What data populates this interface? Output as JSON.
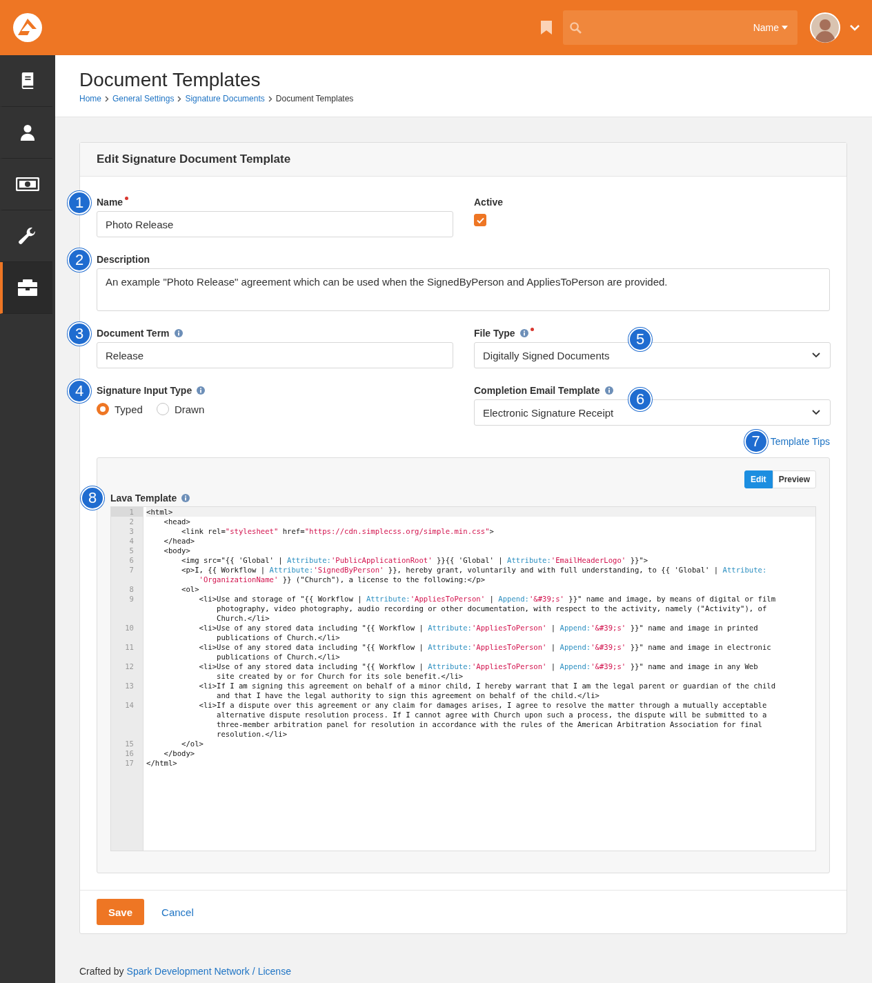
{
  "header": {
    "search_scope": "Name"
  },
  "sidebar": {
    "items": [
      {
        "kind": "book",
        "selected": false
      },
      {
        "kind": "person",
        "selected": false
      },
      {
        "kind": "money",
        "selected": false
      },
      {
        "kind": "wrench",
        "selected": false
      },
      {
        "kind": "briefcase",
        "selected": true
      }
    ]
  },
  "page": {
    "title": "Document Templates",
    "breadcrumbs": [
      "Home",
      "General Settings",
      "Signature Documents",
      "Document Templates"
    ]
  },
  "panel": {
    "title": "Edit Signature Document Template",
    "name": {
      "label": "Name",
      "required": true,
      "callout": "1",
      "value": "Photo Release"
    },
    "active": {
      "label": "Active",
      "checked": true
    },
    "description": {
      "label": "Description",
      "callout": "2",
      "value": "An example \"Photo Release\" agreement which can be used when the SignedByPerson and AppliesToPerson are provided."
    },
    "document_term": {
      "label": "Document Term",
      "callout": "3",
      "value": "Release"
    },
    "file_type": {
      "label": "File Type",
      "required": true,
      "callout": "5",
      "value": "Digitally Signed Documents"
    },
    "signature_input_type": {
      "label": "Signature Input Type",
      "callout": "4",
      "options": [
        {
          "label": "Typed",
          "selected": true
        },
        {
          "label": "Drawn",
          "selected": false
        }
      ]
    },
    "completion_email_template": {
      "label": "Completion Email Template",
      "callout": "6",
      "value": "Electronic Signature Receipt"
    },
    "template_tips": {
      "label": "Template Tips",
      "callout": "7"
    },
    "lava_template": {
      "label": "Lava Template",
      "callout": "8",
      "mode_tabs": [
        {
          "label": "Edit",
          "selected": true
        },
        {
          "label": "Preview",
          "selected": false
        }
      ],
      "code_lines": [
        {
          "number": "1",
          "active": true,
          "rows": [
            [
              {
                "kind": "plain",
                "text": "<html>"
              }
            ]
          ]
        },
        {
          "number": "2",
          "active": false,
          "rows": [
            [
              {
                "kind": "plain",
                "text": "    <head>"
              }
            ]
          ]
        },
        {
          "number": "3",
          "active": false,
          "rows": [
            [
              {
                "kind": "plain",
                "text": "        <link rel="
              },
              {
                "kind": "string",
                "text": "\"stylesheet\""
              },
              {
                "kind": "plain",
                "text": " href="
              },
              {
                "kind": "string",
                "text": "\"https://cdn.simplecss.org/simple.min.css\""
              },
              {
                "kind": "plain",
                "text": ">"
              }
            ]
          ]
        },
        {
          "number": "4",
          "active": false,
          "rows": [
            [
              {
                "kind": "plain",
                "text": "    </head>"
              }
            ]
          ]
        },
        {
          "number": "5",
          "active": false,
          "rows": [
            [
              {
                "kind": "plain",
                "text": "    <body>"
              }
            ]
          ]
        },
        {
          "number": "6",
          "active": false,
          "rows": [
            [
              {
                "kind": "plain",
                "text": "        <img src=\"{{ 'Global' | "
              },
              {
                "kind": "keyword",
                "text": "Attribute:"
              },
              {
                "kind": "string",
                "text": "'PublicApplicationRoot'"
              },
              {
                "kind": "plain",
                "text": " }}{{ 'Global' | "
              },
              {
                "kind": "keyword",
                "text": "Attribute:"
              },
              {
                "kind": "string",
                "text": "'EmailHeaderLogo'"
              },
              {
                "kind": "plain",
                "text": " }}\">"
              }
            ]
          ]
        },
        {
          "number": "7",
          "active": false,
          "rows": [
            [
              {
                "kind": "plain",
                "text": "        <p>I, {{ Workflow | "
              },
              {
                "kind": "keyword",
                "text": "Attribute:"
              },
              {
                "kind": "string",
                "text": "'SignedByPerson'"
              },
              {
                "kind": "plain",
                "text": " }}, hereby grant, voluntarily and with full understanding, to {{ 'Global' | "
              },
              {
                "kind": "keyword",
                "text": "Attribute:"
              }
            ],
            [
              {
                "kind": "plain",
                "text": "            "
              },
              {
                "kind": "string",
                "text": "'OrganizationName'"
              },
              {
                "kind": "plain",
                "text": " }} (\"Church\"), a license to the following:</p>"
              }
            ]
          ]
        },
        {
          "number": "8",
          "active": false,
          "rows": [
            [
              {
                "kind": "plain",
                "text": "        <ol>"
              }
            ]
          ]
        },
        {
          "number": "9",
          "active": false,
          "rows": [
            [
              {
                "kind": "plain",
                "text": "            <li>Use and storage of \"{{ Workflow | "
              },
              {
                "kind": "keyword",
                "text": "Attribute:"
              },
              {
                "kind": "string",
                "text": "'AppliesToPerson'"
              },
              {
                "kind": "plain",
                "text": " | "
              },
              {
                "kind": "keyword",
                "text": "Append:"
              },
              {
                "kind": "string",
                "text": "'&#39;s'"
              },
              {
                "kind": "plain",
                "text": " }}\" name and image, by means of digital or film"
              }
            ],
            [
              {
                "kind": "plain",
                "text": "                photography, video photography, audio recording or other documentation, with respect to the activity, namely (\"Activity\"), of"
              }
            ],
            [
              {
                "kind": "plain",
                "text": "                Church.</li>"
              }
            ]
          ]
        },
        {
          "number": "10",
          "active": false,
          "rows": [
            [
              {
                "kind": "plain",
                "text": "            <li>Use of any stored data including \"{{ Workflow | "
              },
              {
                "kind": "keyword",
                "text": "Attribute:"
              },
              {
                "kind": "string",
                "text": "'AppliesToPerson'"
              },
              {
                "kind": "plain",
                "text": " | "
              },
              {
                "kind": "keyword",
                "text": "Append:"
              },
              {
                "kind": "string",
                "text": "'&#39;s'"
              },
              {
                "kind": "plain",
                "text": " }}\" name and image in printed"
              }
            ],
            [
              {
                "kind": "plain",
                "text": "                publications of Church.</li>"
              }
            ]
          ]
        },
        {
          "number": "11",
          "active": false,
          "rows": [
            [
              {
                "kind": "plain",
                "text": "            <li>Use of any stored data including \"{{ Workflow | "
              },
              {
                "kind": "keyword",
                "text": "Attribute:"
              },
              {
                "kind": "string",
                "text": "'AppliesToPerson'"
              },
              {
                "kind": "plain",
                "text": " | "
              },
              {
                "kind": "keyword",
                "text": "Append:"
              },
              {
                "kind": "string",
                "text": "'&#39;s'"
              },
              {
                "kind": "plain",
                "text": " }}\" name and image in electronic"
              }
            ],
            [
              {
                "kind": "plain",
                "text": "                publications of Church.</li>"
              }
            ]
          ]
        },
        {
          "number": "12",
          "active": false,
          "rows": [
            [
              {
                "kind": "plain",
                "text": "            <li>Use of any stored data including \"{{ Workflow | "
              },
              {
                "kind": "keyword",
                "text": "Attribute:"
              },
              {
                "kind": "string",
                "text": "'AppliesToPerson'"
              },
              {
                "kind": "plain",
                "text": " | "
              },
              {
                "kind": "keyword",
                "text": "Append:"
              },
              {
                "kind": "string",
                "text": "'&#39;s'"
              },
              {
                "kind": "plain",
                "text": " }}\" name and image in any Web"
              }
            ],
            [
              {
                "kind": "plain",
                "text": "                site created by or for Church for its sole benefit.</li>"
              }
            ]
          ]
        },
        {
          "number": "13",
          "active": false,
          "rows": [
            [
              {
                "kind": "plain",
                "text": "            <li>If I am signing this agreement on behalf of a minor child, I hereby warrant that I am the legal parent or guardian of the child"
              }
            ],
            [
              {
                "kind": "plain",
                "text": "                and that I have the legal authority to sign this agreement on behalf of the child.</li>"
              }
            ]
          ]
        },
        {
          "number": "14",
          "active": false,
          "rows": [
            [
              {
                "kind": "plain",
                "text": "            <li>If a dispute over this agreement or any claim for damages arises, I agree to resolve the matter through a mutually acceptable"
              }
            ],
            [
              {
                "kind": "plain",
                "text": "                alternative dispute resolution process. If I cannot agree with Church upon such a process, the dispute will be submitted to a"
              }
            ],
            [
              {
                "kind": "plain",
                "text": "                three-member arbitration panel for resolution in accordance with the rules of the American Arbitration Association for final"
              }
            ],
            [
              {
                "kind": "plain",
                "text": "                resolution.</li>"
              }
            ]
          ]
        },
        {
          "number": "15",
          "active": false,
          "rows": [
            [
              {
                "kind": "plain",
                "text": "        </ol>"
              }
            ]
          ]
        },
        {
          "number": "16",
          "active": false,
          "rows": [
            [
              {
                "kind": "plain",
                "text": "    </body>"
              }
            ]
          ]
        },
        {
          "number": "17",
          "active": false,
          "rows": [
            [
              {
                "kind": "plain",
                "text": "</html>"
              }
            ]
          ]
        }
      ]
    },
    "buttons": {
      "save": "Save",
      "cancel": "Cancel"
    }
  },
  "footer": {
    "prefix": "Crafted by",
    "links": [
      "Spark Development Network",
      "License"
    ],
    "separator": "/"
  }
}
